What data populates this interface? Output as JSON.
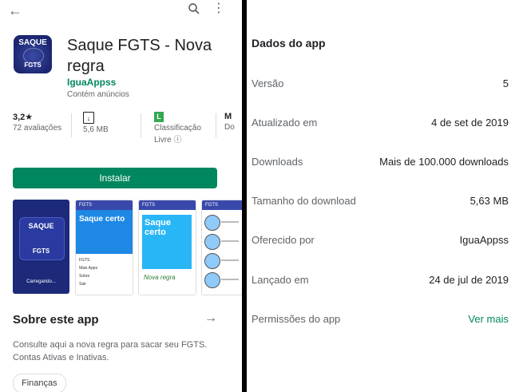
{
  "left": {
    "app": {
      "icon_top_text": "SAQUE",
      "icon_bottom_text": "FGTS",
      "title": "Saque FGTS - Nova regra",
      "developer": "IguaAppss",
      "ads_note": "Contém anúncios"
    },
    "stats": {
      "rating": "3,2★",
      "reviews": "72 avaliações",
      "size": "5,6 MB",
      "content_rating_badge": "L",
      "classification": "Classificação",
      "classification_value": "Livre ⓘ",
      "extra_partial": "M",
      "extra_partial2": "Do"
    },
    "install_label": "Instalar",
    "screenshots": {
      "s1_top": "SAQUE",
      "s1_bottom": "FGTS",
      "s1_loading": "Carregando...",
      "s2_bar": "FGTS",
      "s2_hero": "Saque certo",
      "s2_items": [
        "FGTS",
        "Mais Apps",
        "Sobre",
        "Sair"
      ],
      "s3_bar": "FGTS",
      "s3_poster": "Saque certo",
      "s3_footer": "Nova regra",
      "s4_bar": "FGTS"
    },
    "about_title": "Sobre este app",
    "description": "Consulte aqui a nova regra para sacar seu FGTS. Contas Ativas e Inativas.",
    "category_chip": "Finanças"
  },
  "right": {
    "title": "Dados do app",
    "rows": [
      {
        "label": "Versão",
        "value": "5"
      },
      {
        "label": "Atualizado em",
        "value": "4 de set de 2019"
      },
      {
        "label": "Downloads",
        "value": "Mais de 100.000 downloads"
      },
      {
        "label": "Tamanho do download",
        "value": "5,63 MB"
      },
      {
        "label": "Oferecido por",
        "value": "IguaAppss"
      },
      {
        "label": "Lançado em",
        "value": "24 de jul de 2019"
      },
      {
        "label": "Permissões do app",
        "value": "Ver mais"
      }
    ]
  },
  "colors": {
    "accent": "#01875f",
    "icon_bg": "#1c2670"
  },
  "icons": {
    "back": "back-arrow-icon",
    "search": "search-icon",
    "more": "more-vert-icon",
    "forward": "arrow-forward-icon",
    "download": "download-icon"
  }
}
